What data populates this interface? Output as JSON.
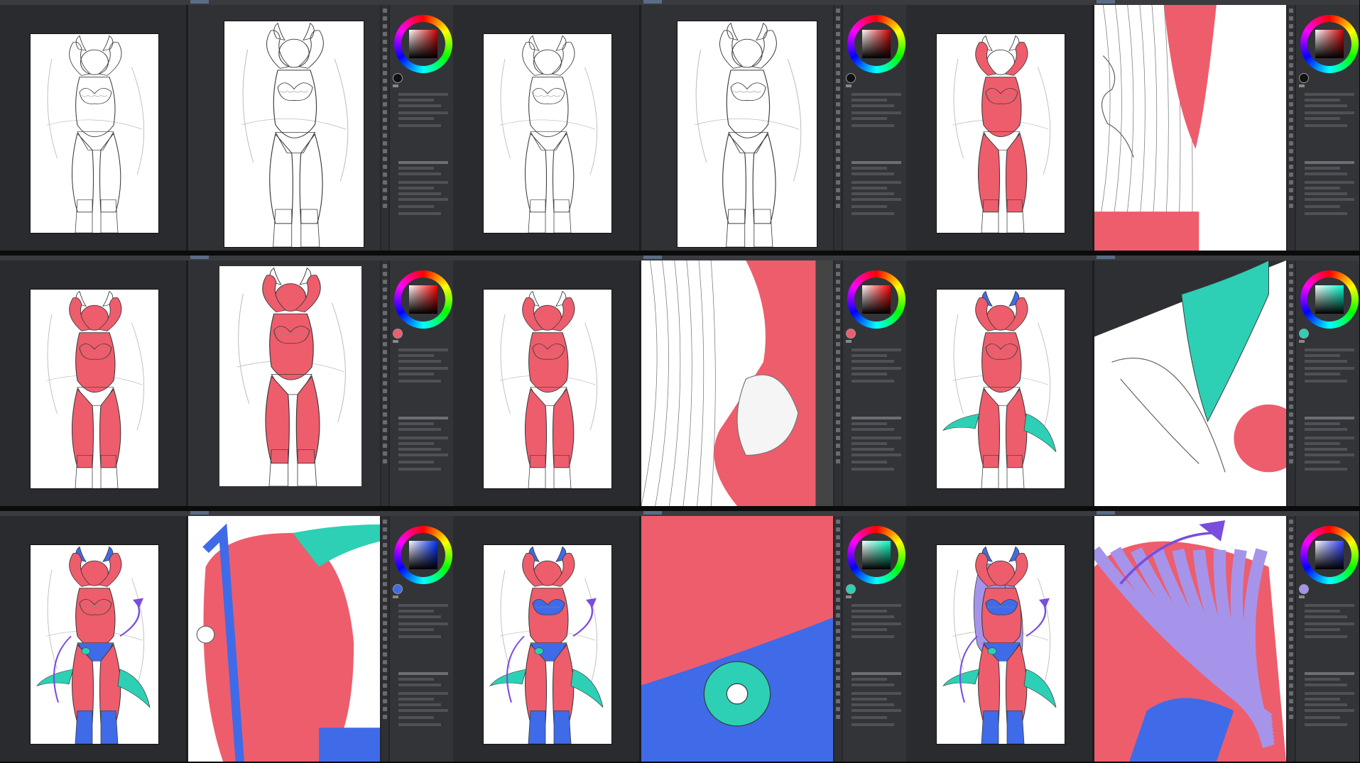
{
  "title": "",
  "colors": {
    "background": "#0b0b0c",
    "red": "#ee5d6c",
    "blue": "#3f6be8",
    "teal": "#2dd0b4",
    "purple": "#7a4dde",
    "lavender": "#a694ea",
    "line": "#3a3a3a"
  },
  "panels": [
    {
      "step": 1,
      "active_color": "#111111",
      "hue": "#cc0000",
      "stage": "lineart",
      "zoom": "lineart"
    },
    {
      "step": 2,
      "active_color": "#111111",
      "hue": "#cc0000",
      "stage": "lineart",
      "zoom": "lineart"
    },
    {
      "step": 3,
      "active_color": "#111111",
      "hue": "#cc0000",
      "stage": "red_partial",
      "zoom": "closeup_red"
    },
    {
      "step": 4,
      "active_color": "#ee5d6c",
      "hue": "#ff0000",
      "stage": "red_full",
      "zoom": "page_red"
    },
    {
      "step": 5,
      "active_color": "#ee5d6c",
      "hue": "#ff0000",
      "stage": "red_full",
      "zoom": "closeup_chest"
    },
    {
      "step": 6,
      "active_color": "#2dd0b4",
      "hue": "#00ffd0",
      "stage": "horns_wings",
      "zoom": "closeup_wing"
    },
    {
      "step": 7,
      "active_color": "#3f6be8",
      "hue": "#0030ff",
      "stage": "tail_flower",
      "zoom": "closeup_garter"
    },
    {
      "step": 8,
      "active_color": "#2dd0b4",
      "hue": "#00ffc0",
      "stage": "blue_lingerie",
      "zoom": "closeup_flower"
    },
    {
      "step": 9,
      "active_color": "#a694ea",
      "hue": "#3040ff",
      "stage": "hair",
      "zoom": "closeup_hair"
    }
  ]
}
